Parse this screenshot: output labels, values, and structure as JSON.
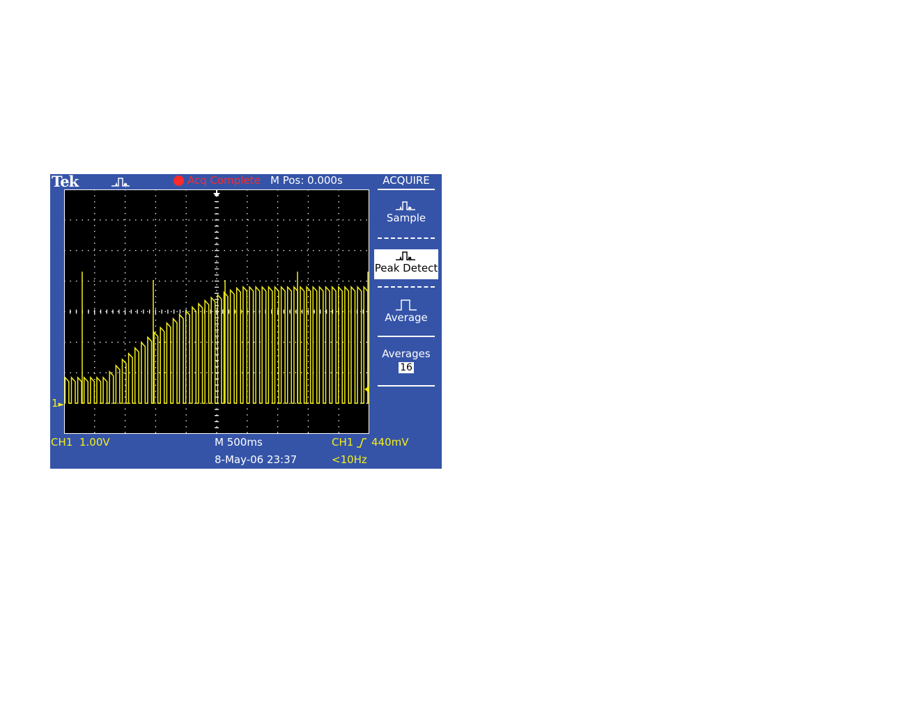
{
  "header": {
    "brand": "Tek",
    "acq_mode_icon": "peak-detect-waveform-icon",
    "run_status": "Acq Complete",
    "run_status_color": "#ff2a2a",
    "horizontal_position": "M Pos: 0.000s"
  },
  "menu": {
    "title": "ACQUIRE",
    "items": [
      {
        "label": "Sample",
        "icon": "sample-waveform-icon",
        "selected": false
      },
      {
        "label": "Peak Detect",
        "icon": "peak-detect-waveform-icon",
        "selected": true
      },
      {
        "label": "Average",
        "icon": "average-waveform-icon",
        "selected": false
      }
    ],
    "averages": {
      "label": "Averages",
      "value": "16"
    }
  },
  "status": {
    "ch1_label": "CH1",
    "ch1_scale": "1.00V",
    "timebase": "M 500ms",
    "trigger_source": "CH1",
    "trigger_slope_icon": "rising-edge-icon",
    "trigger_level": "440mV",
    "date_time": "8-May-06 23:37",
    "trigger_frequency": "<10Hz",
    "ch1_ground_marker": "1"
  },
  "colors": {
    "bezel": "#3554a8",
    "screen": "#000000",
    "trace": "#f5ef1a",
    "graticule": "#ffffff"
  }
}
